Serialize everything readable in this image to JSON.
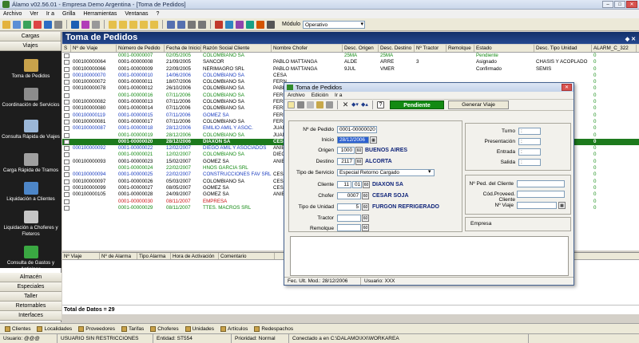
{
  "window": {
    "title": "Álamo v02.56.01 - Empresa Demo Argentina - [Toma de Pedidos]"
  },
  "menu": [
    "Archivo",
    "Ver",
    "Ir a",
    "Grilla",
    "Herramientas",
    "Ventanas",
    "?"
  ],
  "toolbar": {
    "modulo_label": "Módulo",
    "modulo_value": "Operativo"
  },
  "sidebar": {
    "top": [
      "Cargas",
      "Viajes"
    ],
    "modules": [
      "Toma de Pedidos",
      "Coordinación de Servicios",
      "Consulta Rápida de Viajes",
      "Carga Rápida de Tramos",
      "Liquidación a Clientes",
      "Liquidación a Choferes y Fleteros",
      "Consulta de Gastos y Anticipos"
    ],
    "bottom": [
      "Almacén",
      "Especiales",
      "Taller",
      "Retornables",
      "Interfaces"
    ]
  },
  "main": {
    "title": "Toma de Pedidos",
    "columns": [
      "S",
      "Nº de Viaje",
      "Número de Pedido",
      "Fecha de Inicio",
      "Razón Social Cliente",
      "Nombre Chofer",
      "Desc. Origen",
      "Desc. Destino",
      "Nº Tractor",
      "Remolque",
      "Estado",
      "Desc. Tipo Unidad",
      "ALARM_C_322"
    ],
    "rows": [
      {
        "viaje": "",
        "pedido": "0001-00000007",
        "fecha": "02/05/2005",
        "cliente": "COLOMBIANO SA",
        "chofer": "",
        "origen": "25MA",
        "destino": "25MA",
        "tractor": "",
        "remolque": "",
        "estado": "Pendiente",
        "unidad": "",
        "alarm": "0",
        "color": "green"
      },
      {
        "viaje": "000100000064",
        "pedido": "0001-00000008",
        "fecha": "21/09/2005",
        "cliente": "SANCOR",
        "chofer": "PABLO MATTANGA",
        "origen": "ALDE",
        "destino": "ARRE",
        "tractor": "3",
        "remolque": "",
        "estado": "Asignado",
        "unidad": "CHASIS Y ACOPLADO",
        "alarm": "0",
        "color": "black"
      },
      {
        "viaje": "000100000066",
        "pedido": "0001-00000009",
        "fecha": "22/09/2005",
        "cliente": "NERIMAGRO SRL",
        "chofer": "PABLO MATTANGA",
        "origen": "9JUL",
        "destino": "VMER",
        "tractor": "",
        "remolque": "",
        "estado": "Confirmado",
        "unidad": "SEMIS",
        "alarm": "0",
        "color": "black"
      },
      {
        "viaje": "000100000070",
        "pedido": "0001-00000010",
        "fecha": "14/06/2006",
        "cliente": "COLOMBIANO SA",
        "chofer": "CESA",
        "origen": "",
        "destino": "",
        "tractor": "",
        "remolque": "",
        "estado": "",
        "unidad": "",
        "alarm": "0",
        "color": "blue"
      },
      {
        "viaje": "000100000072",
        "pedido": "0001-00000011",
        "fecha": "18/07/2006",
        "cliente": "COLOMBIANO SA",
        "chofer": "FERN",
        "origen": "",
        "destino": "",
        "tractor": "",
        "remolque": "",
        "estado": "",
        "unidad": "",
        "alarm": "0",
        "color": "black"
      },
      {
        "viaje": "000100000078",
        "pedido": "0001-00000012",
        "fecha": "26/10/2006",
        "cliente": "COLOMBIANO SA",
        "chofer": "PABL",
        "origen": "",
        "destino": "",
        "tractor": "",
        "remolque": "",
        "estado": "",
        "unidad": "",
        "alarm": "0",
        "color": "black"
      },
      {
        "viaje": "",
        "pedido": "0001-00000016",
        "fecha": "07/11/2006",
        "cliente": "COLOMBIANO SA",
        "chofer": "FERN",
        "origen": "",
        "destino": "",
        "tractor": "",
        "remolque": "",
        "estado": "",
        "unidad": "",
        "alarm": "0",
        "color": "green"
      },
      {
        "viaje": "000100000082",
        "pedido": "0001-00000013",
        "fecha": "07/11/2006",
        "cliente": "COLOMBIANO SA",
        "chofer": "FERN",
        "origen": "",
        "destino": "",
        "tractor": "",
        "remolque": "",
        "estado": "",
        "unidad": "",
        "alarm": "0",
        "color": "black"
      },
      {
        "viaje": "000100000080",
        "pedido": "0001-00000014",
        "fecha": "07/11/2006",
        "cliente": "COLOMBIANO SA",
        "chofer": "FERN",
        "origen": "",
        "destino": "",
        "tractor": "",
        "remolque": "",
        "estado": "",
        "unidad": "",
        "alarm": "0",
        "color": "black"
      },
      {
        "viaje": "000100000119",
        "pedido": "0001-00000015",
        "fecha": "07/11/2006",
        "cliente": "GOMEZ SA",
        "chofer": "FERN",
        "origen": "",
        "destino": "",
        "tractor": "",
        "remolque": "",
        "estado": "",
        "unidad": "",
        "alarm": "0",
        "color": "blue"
      },
      {
        "viaje": "000100000081",
        "pedido": "0001-00000017",
        "fecha": "07/11/2006",
        "cliente": "COLOMBIANO SA",
        "chofer": "FERN",
        "origen": "",
        "destino": "",
        "tractor": "",
        "remolque": "",
        "estado": "",
        "unidad": "",
        "alarm": "0",
        "color": "black"
      },
      {
        "viaje": "000100000087",
        "pedido": "0001-00000018",
        "fecha": "28/12/2006",
        "cliente": "EMILIO AMIL Y ASOC.",
        "chofer": "JUAN",
        "origen": "",
        "destino": "",
        "tractor": "",
        "remolque": "",
        "estado": "",
        "unidad": "",
        "alarm": "0",
        "color": "blue"
      },
      {
        "viaje": "",
        "pedido": "0001-00000019",
        "fecha": "28/12/2006",
        "cliente": "COLOMBIANO SA",
        "chofer": "JUAN",
        "origen": "",
        "destino": "",
        "tractor": "",
        "remolque": "",
        "estado": "",
        "unidad": "",
        "alarm": "0",
        "color": "green"
      },
      {
        "viaje": "",
        "pedido": "0001-00000020",
        "fecha": "28/12/2006",
        "cliente": "DIAXON SA",
        "chofer": "CESA",
        "origen": "",
        "destino": "",
        "tractor": "",
        "remolque": "",
        "estado": "",
        "unidad": "GER",
        "alarm": "0",
        "color": "selected"
      },
      {
        "viaje": "000100000092",
        "pedido": "0001-00000022",
        "fecha": "12/02/2007",
        "cliente": "DIEGO AMIL Y ASOCIADOS",
        "chofer": "ANIB",
        "origen": "",
        "destino": "",
        "tractor": "",
        "remolque": "",
        "estado": "",
        "unidad": "",
        "alarm": "0",
        "color": "blue"
      },
      {
        "viaje": "",
        "pedido": "0001-00000021",
        "fecha": "12/02/2007",
        "cliente": "COLOMBIANO SA",
        "chofer": "DIEG",
        "origen": "",
        "destino": "",
        "tractor": "",
        "remolque": "",
        "estado": "",
        "unidad": "",
        "alarm": "0",
        "color": "green"
      },
      {
        "viaje": "000100000093",
        "pedido": "0001-00000023",
        "fecha": "15/02/2007",
        "cliente": "GOMEZ SA",
        "chofer": "ANIB",
        "origen": "",
        "destino": "",
        "tractor": "",
        "remolque": "",
        "estado": "",
        "unidad": "",
        "alarm": "0",
        "color": "black"
      },
      {
        "viaje": "",
        "pedido": "0001-00000024",
        "fecha": "22/02/2007",
        "cliente": "HNOS GARCIA SRL",
        "chofer": "",
        "origen": "",
        "destino": "",
        "tractor": "",
        "remolque": "",
        "estado": "",
        "unidad": "",
        "alarm": "0",
        "color": "green"
      },
      {
        "viaje": "000100000094",
        "pedido": "0001-00000025",
        "fecha": "22/02/2007",
        "cliente": "CONSTRUCCIONES FAV SRL",
        "chofer": "CESA",
        "origen": "",
        "destino": "",
        "tractor": "",
        "remolque": "",
        "estado": "",
        "unidad": "",
        "alarm": "0",
        "color": "blue"
      },
      {
        "viaje": "000100000097",
        "pedido": "0001-00000026",
        "fecha": "05/03/2007",
        "cliente": "COLOMBIANO SA",
        "chofer": "CESA",
        "origen": "",
        "destino": "",
        "tractor": "",
        "remolque": "",
        "estado": "",
        "unidad": "",
        "alarm": "0",
        "color": "black"
      },
      {
        "viaje": "000100000099",
        "pedido": "0001-00000027",
        "fecha": "08/05/2007",
        "cliente": "GOMEZ SA",
        "chofer": "CESA",
        "origen": "",
        "destino": "",
        "tractor": "",
        "remolque": "",
        "estado": "",
        "unidad": "",
        "alarm": "0",
        "color": "black"
      },
      {
        "viaje": "000100000105",
        "pedido": "0001-00000028",
        "fecha": "24/09/2007",
        "cliente": "GOMEZ SA",
        "chofer": "ANIB",
        "origen": "",
        "destino": "",
        "tractor": "",
        "remolque": "",
        "estado": "",
        "unidad": "",
        "alarm": "0",
        "color": "black"
      },
      {
        "viaje": "",
        "pedido": "0001-00000030",
        "fecha": "08/11/2007",
        "cliente": "EMPRESA",
        "chofer": "",
        "origen": "",
        "destino": "",
        "tractor": "",
        "remolque": "",
        "estado": "",
        "unidad": "",
        "alarm": "0",
        "color": "red"
      },
      {
        "viaje": "",
        "pedido": "0001-00000029",
        "fecha": "08/11/2007",
        "cliente": "TTES. MACROS SRL",
        "chofer": "",
        "origen": "",
        "destino": "",
        "tractor": "",
        "remolque": "",
        "estado": "",
        "unidad": "",
        "alarm": "0",
        "color": "green"
      }
    ]
  },
  "alarms": {
    "columns": [
      "Nº Viaje",
      "Nº de Alarma",
      "Tipo Alarma",
      "Hora de Activación",
      "Comentario"
    ]
  },
  "totals": "Total de Datos = 29",
  "shortcuts": [
    "Clientes",
    "Localidades",
    "Proveedores",
    "Tarifas",
    "Choferes",
    "Unidades",
    "Artículos",
    "Redespachos"
  ],
  "status": [
    "Usuario: @@@",
    "USUARIO SIN RESTRICCIONES",
    "Entidad: ST554",
    "Prioridad: Normal",
    "Conectado a  en C:\\DALAMO\\XX\\WORKAREA"
  ],
  "dialog": {
    "title": "Toma de Pedidos",
    "menu": [
      "Archivo",
      "Edición",
      "Ir a"
    ],
    "pending_label": "Pendiente",
    "generate_label": "Generar Viaje",
    "fields": {
      "pedido_label": "Nº de Pedido",
      "pedido_value": "0001-00000020",
      "inicio_label": "Inicio",
      "inicio_value": "28/12/2006",
      "origen_label": "Origen",
      "origen_code": "1000",
      "origen_name": "BUENOS AIRES",
      "destino_label": "Destino",
      "destino_code": "2117",
      "destino_name": "ALCORTA",
      "servicio_label": "Tipo de Servicio",
      "servicio_value": "Especial Retorno Cargado",
      "cliente_label": "Cliente",
      "cliente_code": "11",
      "cliente_suc": "01",
      "cliente_name": "DIAXON SA",
      "chofer_label": "Chofer",
      "chofer_code": "0007",
      "chofer_name": "CESAR SOJA",
      "unidad_label": "Tipo de Unidad",
      "unidad_code": "5",
      "unidad_name": "FURGON REFRIGERADO",
      "tractor_label": "Tractor",
      "remolque_label": "Remolque"
    },
    "right": {
      "turno": "Turno",
      "presentacion": "Presentación",
      "entrada": "Entrada",
      "salida": "Salida",
      "time_value": ":",
      "ped_cliente": "Nº Ped. del Cliente",
      "cod_proveed": "Cód.Proveed. Cliente",
      "nro_viaje": "Nº Viaje",
      "empresa": "Empresa"
    },
    "status_mod": "Fec. Ult. Mod.: 28/12/2006",
    "status_user": "Usuario: XXX"
  }
}
